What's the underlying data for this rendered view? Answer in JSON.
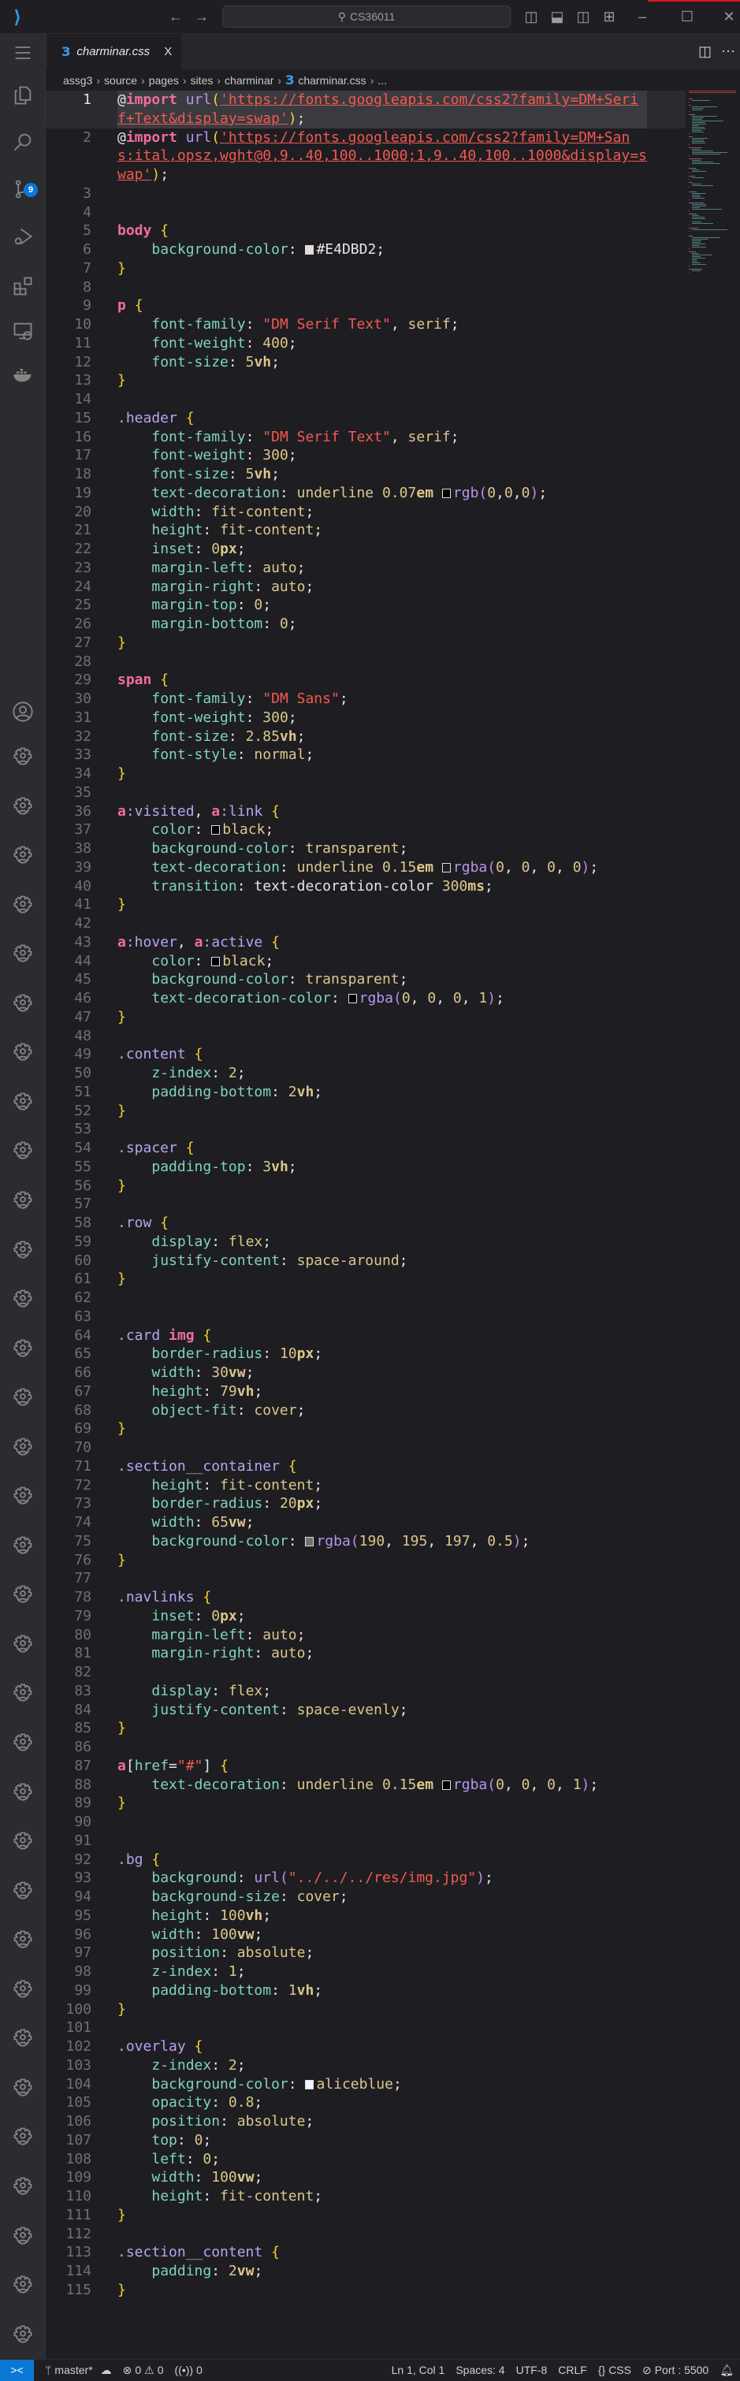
{
  "titlebar": {
    "search_text": "CS36011",
    "icons": [
      "vscode-logo-icon",
      "back-arrow-icon",
      "forward-arrow-icon",
      "toggle-primary-sidebar-icon",
      "toggle-panel-icon",
      "toggle-secondary-sidebar-icon",
      "customize-layout-icon",
      "minimize-icon",
      "maximize-icon",
      "close-icon"
    ]
  },
  "activity_bar": {
    "items": [
      "menu",
      "explorer",
      "search",
      "source-control",
      "run-and-debug",
      "extensions",
      "remote-explorer",
      "docker",
      "accounts",
      "manage"
    ],
    "source_control_badge": "9"
  },
  "tab": {
    "label": "charminar.css",
    "close": "X"
  },
  "breadcrumb": [
    "assg3",
    "source",
    "pages",
    "sites",
    "charminar",
    "charminar.css",
    "..."
  ],
  "editor": {
    "active_line": 1,
    "lines": [
      "@import url('https://fonts.googleapis.com/css2?family=DM+Serif+Text&display=swap');",
      "@import url('https://fonts.googleapis.com/css2?family=DM+Sans:ital,opsz,wght@0,9..40,100..1000;1,9..40,100..1000&display=swap');",
      "",
      "",
      "body {",
      "    background-color: #E4DBD2;",
      "}",
      "",
      "p {",
      "    font-family: \"DM Serif Text\", serif;",
      "    font-weight: 400;",
      "    font-size: 5vh;",
      "}",
      "",
      ".header {",
      "    font-family: \"DM Serif Text\", serif;",
      "    font-weight: 300;",
      "    font-size: 5vh;",
      "    text-decoration: underline 0.07em rgb(0,0,0);",
      "    width: fit-content;",
      "    height: fit-content;",
      "    inset: 0px;",
      "    margin-left: auto;",
      "    margin-right: auto;",
      "    margin-top: 0;",
      "    margin-bottom: 0;",
      "}",
      "",
      "span {",
      "    font-family: \"DM Sans\";",
      "    font-weight: 300;",
      "    font-size: 2.85vh;",
      "    font-style: normal;",
      "}",
      "",
      "a:visited, a:link {",
      "    color: black;",
      "    background-color: transparent;",
      "    text-decoration: underline 0.15em rgba(0, 0, 0, 0);",
      "    transition: text-decoration-color 300ms;",
      "}",
      "",
      "a:hover, a:active {",
      "    color: black;",
      "    background-color: transparent;",
      "    text-decoration-color: rgba(0, 0, 0, 1);",
      "}",
      "",
      ".content {",
      "    z-index: 2;",
      "    padding-bottom: 2vh;",
      "}",
      "",
      ".spacer {",
      "    padding-top: 3vh;",
      "}",
      "",
      ".row {",
      "    display: flex;",
      "    justify-content: space-around;",
      "}",
      "",
      "",
      ".card img {",
      "    border-radius: 10px;",
      "    width: 30vw;",
      "    height: 79vh;",
      "    object-fit: cover;",
      "}",
      "",
      ".section__container {",
      "    height: fit-content;",
      "    border-radius: 20px;",
      "    width: 65vw;",
      "    background-color: rgba(190, 195, 197, 0.5);",
      "}",
      "",
      ".navlinks {",
      "    inset: 0px;",
      "    margin-left: auto;",
      "    margin-right: auto;",
      "",
      "    display: flex;",
      "    justify-content: space-evenly;",
      "}",
      "",
      "a[href=\"#\"] {",
      "    text-decoration: underline 0.15em rgba(0, 0, 0, 1);",
      "}",
      "",
      "",
      ".bg {",
      "    background: url(\"../../../res/img.jpg\");",
      "    background-size: cover;",
      "    height: 100vh;",
      "    width: 100vw;",
      "    position: absolute;",
      "    z-index: 1;",
      "    padding-bottom: 1vh;",
      "}",
      "",
      ".overlay {",
      "    z-index: 2;",
      "    background-color: aliceblue;",
      "    opacity: 0.8;",
      "    position: absolute;",
      "    top: 0;",
      "    left: 0;",
      "    width: 100vw;",
      "    height: fit-content;",
      "}",
      "",
      ".section__content {",
      "    padding: 2vw;",
      "}"
    ]
  },
  "status_bar": {
    "branch": "master*",
    "errors": "0",
    "warnings": "0",
    "ports_forwarded": "0",
    "cursor": "Ln 1, Col 1",
    "indent": "Spaces: 4",
    "encoding": "UTF-8",
    "eol": "CRLF",
    "language": "CSS",
    "live_server": "Port : 5500"
  },
  "colors": {
    "accent": "#0a78d4",
    "badge": "#0a78d7"
  }
}
